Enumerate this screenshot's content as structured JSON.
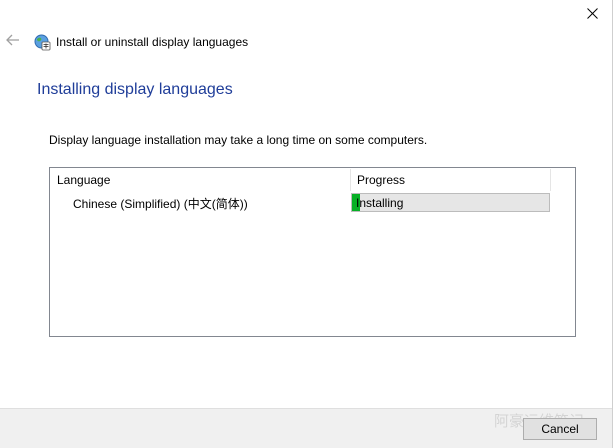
{
  "window": {
    "title": "Install or uninstall display languages",
    "close_icon": "close-icon",
    "back_icon": "back-arrow-icon",
    "app_icon": "language-globe-icon"
  },
  "main": {
    "heading": "Installing display languages",
    "description": "Display language installation may take a long time on some computers."
  },
  "table": {
    "columns": [
      "Language",
      "Progress"
    ],
    "rows": [
      {
        "language": "Chinese (Simplified) (中文(简体))",
        "status": "Installing",
        "progress_fraction": 0.04
      }
    ]
  },
  "footer": {
    "cancel_label": "Cancel",
    "watermark": "阿豪运维笔记"
  },
  "colors": {
    "heading": "#1f3d99",
    "progress_fill": "#06b025",
    "progress_track": "#e6e6e6",
    "footer_background": "#f0f0f0"
  }
}
